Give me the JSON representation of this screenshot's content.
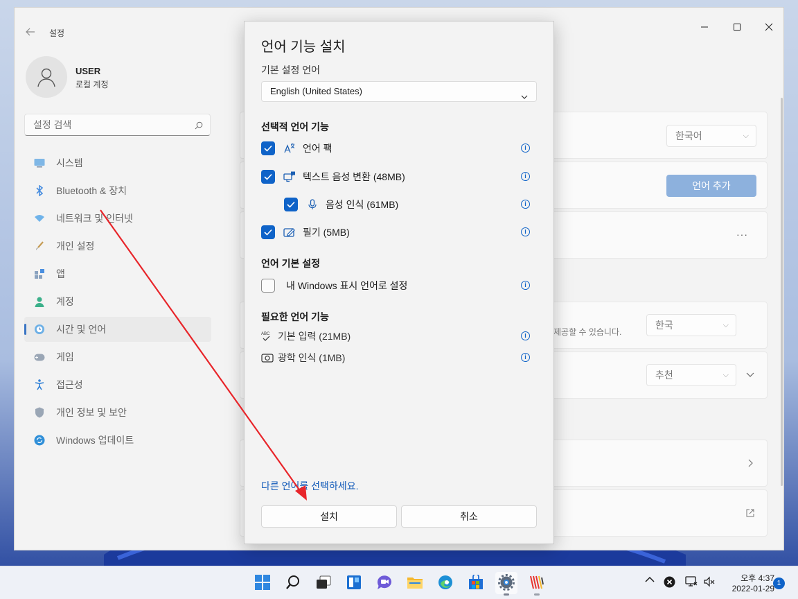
{
  "settings": {
    "title": "설정",
    "user": {
      "name": "USER",
      "account_type": "로컬 계정"
    },
    "search_placeholder": "설정 검색",
    "nav": [
      {
        "label": "시스템",
        "icon": "monitor-icon"
      },
      {
        "label": "Bluetooth & 장치",
        "icon": "bluetooth-icon"
      },
      {
        "label": "네트워크 및 인터넷",
        "icon": "wifi-icon"
      },
      {
        "label": "개인 설정",
        "icon": "brush-icon"
      },
      {
        "label": "앱",
        "icon": "apps-icon"
      },
      {
        "label": "계정",
        "icon": "person-icon"
      },
      {
        "label": "시간 및 언어",
        "icon": "globe-clock-icon",
        "active": true
      },
      {
        "label": "게임",
        "icon": "gamepad-icon"
      },
      {
        "label": "접근성",
        "icon": "accessibility-icon"
      },
      {
        "label": "개인 정보 및 보안",
        "icon": "shield-icon"
      },
      {
        "label": "Windows 업데이트",
        "icon": "update-icon"
      }
    ],
    "content": {
      "language_value": "한국어",
      "add_language_label": "언어 추가",
      "more_label": "···",
      "region_hint": "제공할 수 있습니다.",
      "region_value": "한국",
      "format_value": "추천"
    }
  },
  "dialog": {
    "title": "언어 기능 설치",
    "preferred_label": "기본 설정 언어",
    "preferred_value": "English (United States)",
    "optional_heading": "선택적 언어 기능",
    "optional_features": [
      {
        "label": "언어 팩",
        "checked": true,
        "icon": "language-pack-icon"
      },
      {
        "label": "텍스트 음성 변환 (48MB)",
        "checked": true,
        "icon": "text-to-speech-icon"
      },
      {
        "label": "음성 인식 (61MB)",
        "checked": true,
        "icon": "microphone-icon"
      },
      {
        "label": "필기 (5MB)",
        "checked": true,
        "icon": "handwriting-icon"
      }
    ],
    "pref_heading": "언어 기본 설정",
    "pref_option": {
      "label": "내 Windows 표시 언어로 설정",
      "checked": false
    },
    "required_heading": "필요한 언어 기능",
    "required_features": [
      {
        "label": "기본 입력 (21MB)",
        "icon": "spellcheck-icon"
      },
      {
        "label": "광학 인식 (1MB)",
        "icon": "camera-icon"
      }
    ],
    "link_text": "다른 언어를 선택하세요.",
    "install_label": "설치",
    "cancel_label": "취소"
  },
  "taskbar": {
    "apps": [
      "start-icon",
      "search-icon",
      "task-view-icon",
      "widgets-icon",
      "chat-icon",
      "file-explorer-icon",
      "edge-icon",
      "store-icon",
      "settings-icon",
      "app-icon"
    ],
    "time": "오후 4:37",
    "date": "2022-01-29",
    "notification_count": "1"
  },
  "colors": {
    "accent": "#0f63c8",
    "arrow": "#e8252a"
  }
}
